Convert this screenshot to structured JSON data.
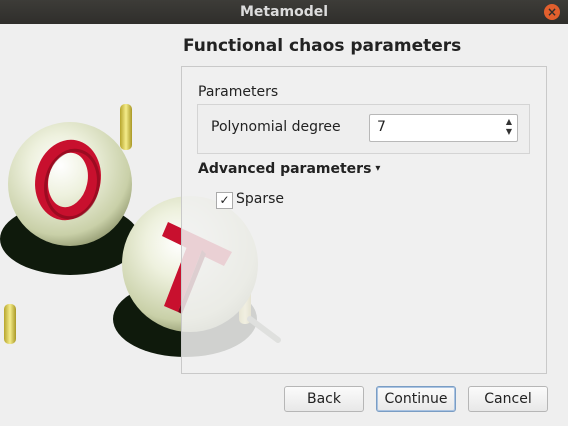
{
  "window": {
    "title": "Metamodel",
    "close_glyph": "×"
  },
  "page": {
    "title": "Functional chaos parameters"
  },
  "parameters": {
    "group_label": "Parameters",
    "polynomial_degree_label": "Polynomial degree",
    "polynomial_degree_value": "7"
  },
  "advanced": {
    "label": "Advanced parameters",
    "toggle_glyph": "▾",
    "sparse_label": "Sparse",
    "sparse_checked": true,
    "check_glyph": "✓"
  },
  "buttons": {
    "back": "Back",
    "continue": "Continue",
    "cancel": "Cancel"
  },
  "logo": {
    "letters": [
      "O",
      "T"
    ]
  },
  "colors": {
    "titlebar": "#2f2e2b",
    "close": "#e25f2d",
    "logo_red": "#c8102e",
    "logo_sphere": "#e8ecd6",
    "logo_yellow": "#d8c84a"
  }
}
